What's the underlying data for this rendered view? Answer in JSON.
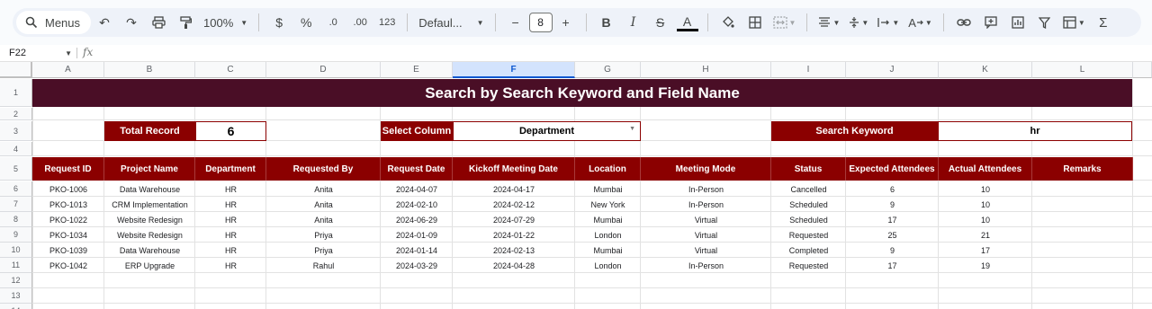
{
  "toolbar": {
    "menus_label": "Menus",
    "zoom": "100%",
    "currency": "$",
    "percent": "%",
    "decimal_decrease": ".0",
    "decimal_increase": ".00",
    "number_format": "123",
    "font_name": "Defaul...",
    "font_size": "8"
  },
  "formula_bar": {
    "cell_ref": "F22",
    "fx": "fx"
  },
  "columns": [
    "A",
    "B",
    "C",
    "D",
    "E",
    "F",
    "G",
    "H",
    "I",
    "J",
    "K",
    "L"
  ],
  "rows": [
    "1",
    "2",
    "3",
    "4",
    "5",
    "6",
    "7",
    "8",
    "9",
    "10",
    "11",
    "12",
    "13",
    "14"
  ],
  "sheet": {
    "title": "Search by Search Keyword and Field Name",
    "total_record_label": "Total Record",
    "total_record_value": "6",
    "select_column_label": "Select Column",
    "select_column_value": "Department",
    "search_keyword_label": "Search Keyword",
    "search_keyword_value": "hr",
    "headers": [
      "Request ID",
      "Project Name",
      "Department",
      "Requested By",
      "Request Date",
      "Kickoff Meeting Date",
      "Location",
      "Meeting Mode",
      "Status",
      "Expected Attendees",
      "Actual Attendees",
      "Remarks"
    ],
    "records": [
      [
        "PKO-1006",
        "Data Warehouse",
        "HR",
        "Anita",
        "2024-04-07",
        "2024-04-17",
        "Mumbai",
        "In-Person",
        "Cancelled",
        "6",
        "10",
        ""
      ],
      [
        "PKO-1013",
        "CRM Implementation",
        "HR",
        "Anita",
        "2024-02-10",
        "2024-02-12",
        "New York",
        "In-Person",
        "Scheduled",
        "9",
        "10",
        ""
      ],
      [
        "PKO-1022",
        "Website Redesign",
        "HR",
        "Anita",
        "2024-06-29",
        "2024-07-29",
        "Mumbai",
        "Virtual",
        "Scheduled",
        "17",
        "10",
        ""
      ],
      [
        "PKO-1034",
        "Website Redesign",
        "HR",
        "Priya",
        "2024-01-09",
        "2024-01-22",
        "London",
        "Virtual",
        "Requested",
        "25",
        "21",
        ""
      ],
      [
        "PKO-1039",
        "Data Warehouse",
        "HR",
        "Priya",
        "2024-01-14",
        "2024-02-13",
        "Mumbai",
        "Virtual",
        "Completed",
        "9",
        "17",
        ""
      ],
      [
        "PKO-1042",
        "ERP Upgrade",
        "HR",
        "Rahul",
        "2024-03-29",
        "2024-04-28",
        "London",
        "In-Person",
        "Requested",
        "17",
        "19",
        ""
      ]
    ]
  },
  "colors": {
    "title_band": "#4a0e26",
    "accent": "#8b0000",
    "selected_column": "#d3e3fd"
  }
}
